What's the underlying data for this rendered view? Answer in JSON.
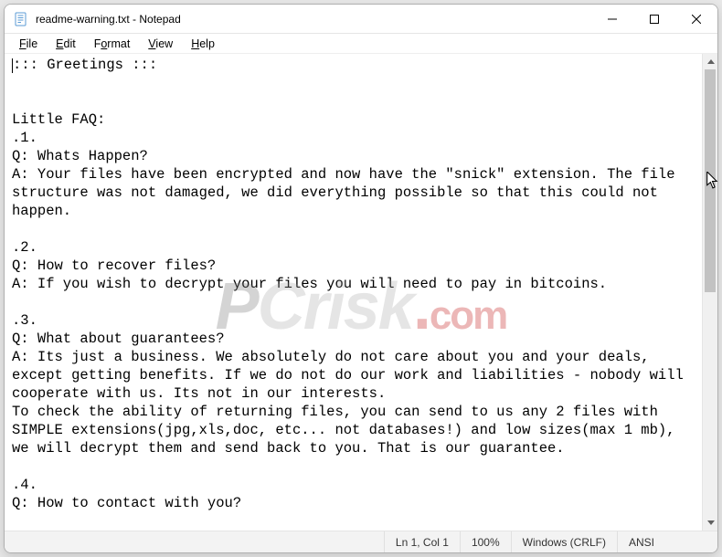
{
  "window": {
    "title": "readme-warning.txt - Notepad",
    "icon": "notepad-icon"
  },
  "controls": {
    "minimize": "minimize",
    "maximize": "maximize",
    "close": "close"
  },
  "menubar": {
    "items": [
      {
        "label": "File",
        "key": "F"
      },
      {
        "label": "Edit",
        "key": "E"
      },
      {
        "label": "Format",
        "key": "o"
      },
      {
        "label": "View",
        "key": "V"
      },
      {
        "label": "Help",
        "key": "H"
      }
    ]
  },
  "document": {
    "body": "::: Greetings :::\n\n\nLittle FAQ:\n.1.\nQ: Whats Happen?\nA: Your files have been encrypted and now have the \"snick\" extension. The file structure was not damaged, we did everything possible so that this could not happen.\n\n.2.\nQ: How to recover files?\nA: If you wish to decrypt your files you will need to pay in bitcoins.\n\n.3.\nQ: What about guarantees?\nA: Its just a business. We absolutely do not care about you and your deals, except getting benefits. If we do not do our work and liabilities - nobody will cooperate with us. Its not in our interests.\nTo check the ability of returning files, you can send to us any 2 files with SIMPLE extensions(jpg,xls,doc, etc... not databases!) and low sizes(max 1 mb), we will decrypt them and send back to you. That is our guarantee.\n\n.4.\nQ: How to contact with you?"
  },
  "statusbar": {
    "position": "Ln 1, Col 1",
    "zoom": "100%",
    "line_ending": "Windows (CRLF)",
    "encoding": "ANSI"
  },
  "watermark": {
    "text_p": "P",
    "text_c": "Crisk",
    "text_dot": ".",
    "text_com": "com"
  }
}
